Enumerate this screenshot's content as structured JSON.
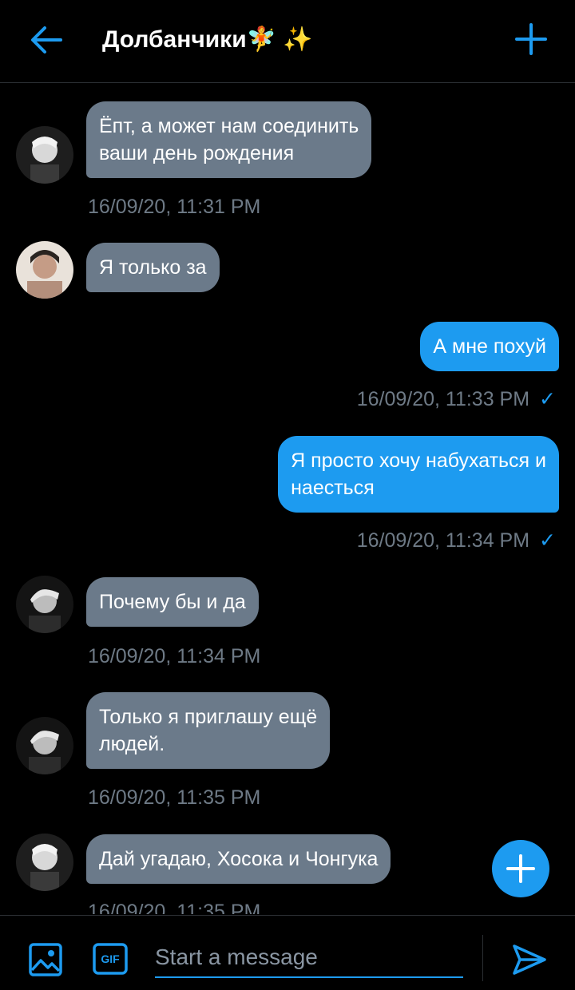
{
  "header": {
    "title": "Долбанчики🧚 ✨",
    "back_icon": "arrow-left-icon",
    "add_icon": "plus-icon"
  },
  "messages": [
    {
      "dir": "in",
      "text_lines": [
        "Ёпт, а может нам соединить",
        "ваши день рождения"
      ],
      "time": "16/09/20, 11:31 PM"
    },
    {
      "dir": "in",
      "text_lines": [
        "Я только за"
      ],
      "time": ""
    },
    {
      "dir": "out",
      "text_lines": [
        "А мне похуй"
      ],
      "time": "16/09/20, 11:33 PM",
      "status": "✓"
    },
    {
      "dir": "out",
      "text_lines": [
        "Я просто хочу набухаться и",
        "наесться"
      ],
      "time": "16/09/20, 11:34 PM",
      "status": "✓"
    },
    {
      "dir": "in",
      "text_lines": [
        "Почему бы и да"
      ],
      "time": "16/09/20, 11:34 PM"
    },
    {
      "dir": "in",
      "text_lines": [
        "Только я приглашу ещё",
        "людей."
      ],
      "time": "16/09/20, 11:35 PM"
    },
    {
      "dir": "in",
      "text_lines": [
        "Дай угадаю, Хосока и Чонгука"
      ],
      "time": "16/09/20, 11:35 PM"
    }
  ],
  "composer": {
    "image_icon": "image-icon",
    "gif_label": "GIF",
    "placeholder": "Start a message",
    "send_icon": "send-icon"
  },
  "fab_icon": "plus-icon",
  "colors": {
    "accent": "#1d9bf0",
    "incoming_bubble": "#6b7a8a",
    "background": "#000000",
    "timestamp": "#6e7a86"
  }
}
